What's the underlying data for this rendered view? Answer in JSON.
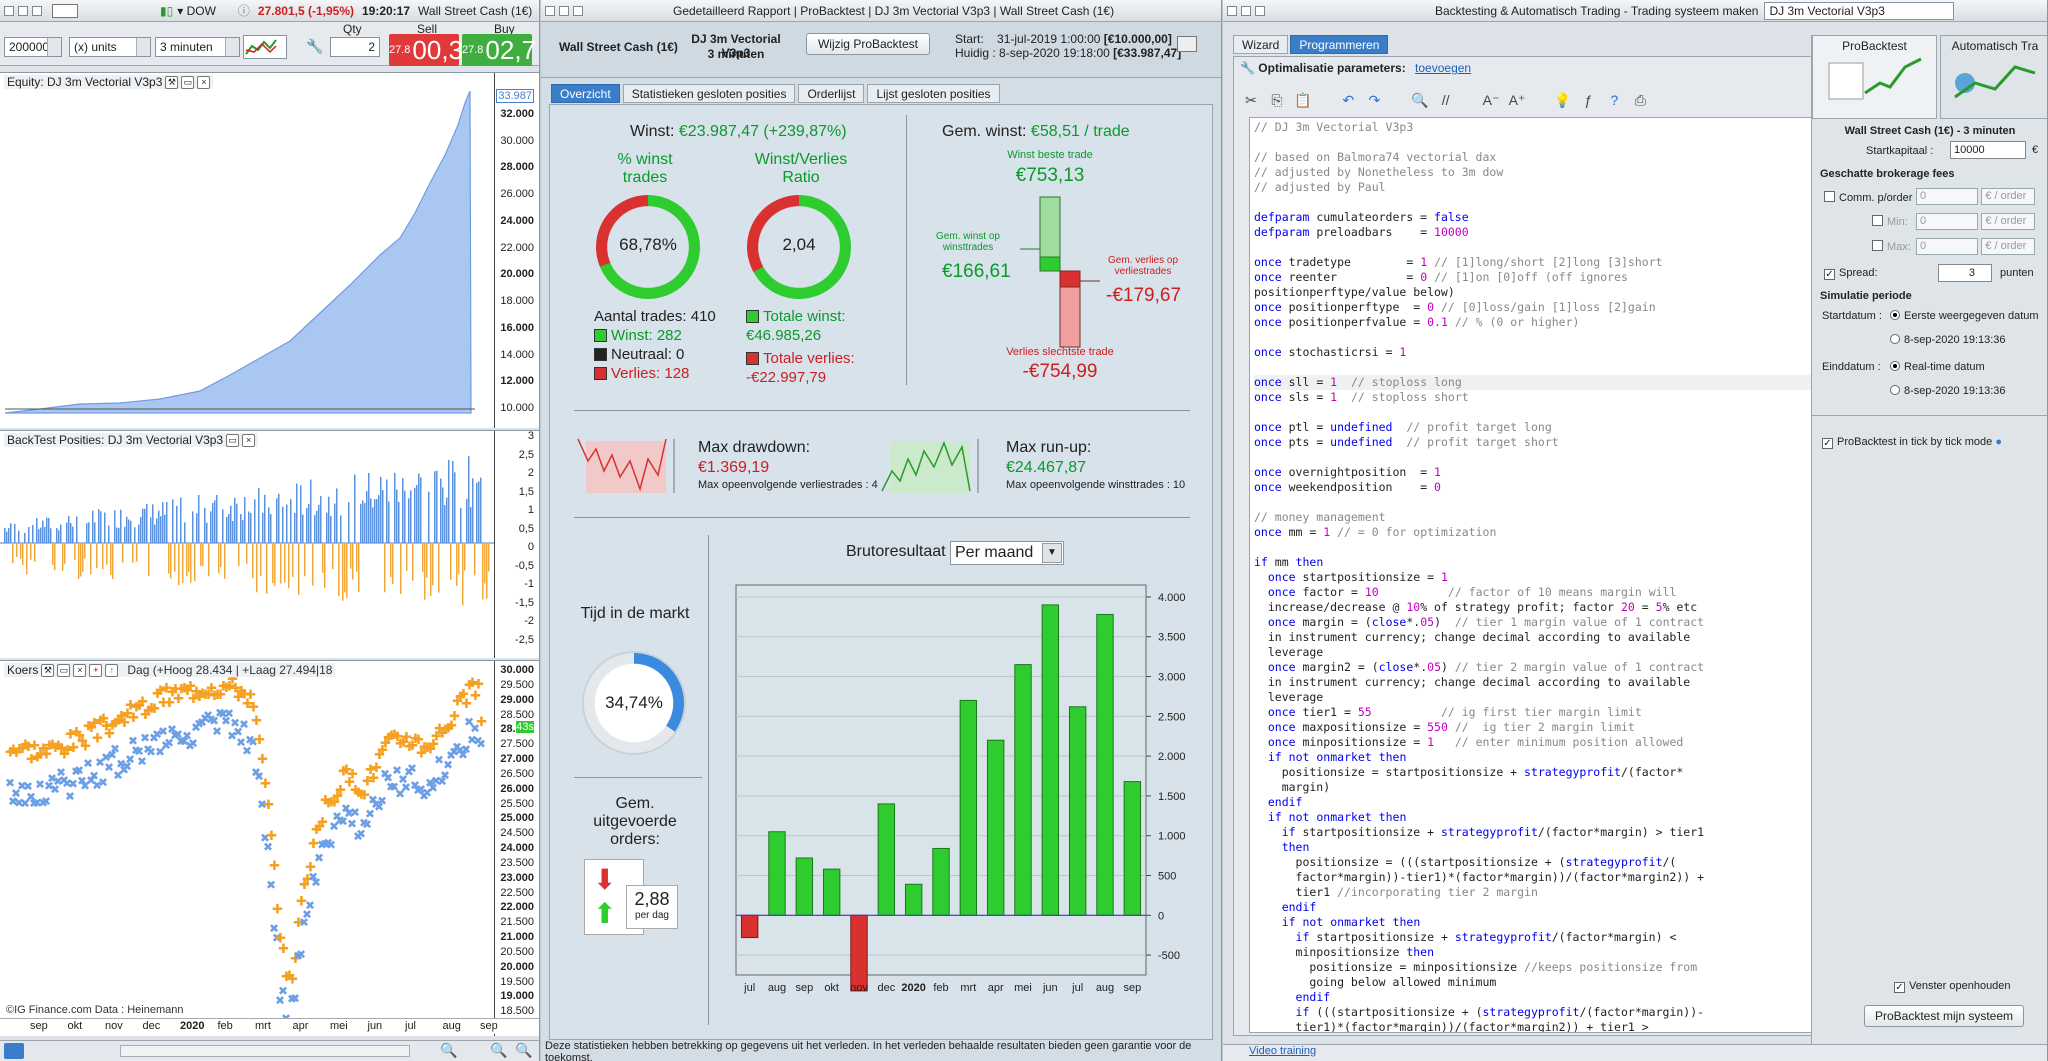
{
  "w1": {
    "title_instrument": "DOW",
    "quote": "27.801,5 (-1,95%)",
    "time": "19:20:17",
    "title_market": "Wall Street Cash (1€)",
    "qty_label": "Qty",
    "sell_label": "Sell",
    "buy_label": "Buy",
    "units_value": "200000",
    "units_select": "(x) units",
    "interval_select": "3 minuten",
    "qty_value": "2",
    "sell_small": "27.8",
    "sell_big": "00,3",
    "buy_small": "27.8",
    "buy_big": "02,7",
    "equity_title": "Equity: DJ 3m Vectorial V3p3",
    "equity_last": "33.987",
    "equity_ticks": [
      "32.000",
      "30.000",
      "28.000",
      "26.000",
      "24.000",
      "22.000",
      "20.000",
      "18.000",
      "16.000",
      "14.000",
      "12.000",
      "10.000"
    ],
    "pos_title": "BackTest Posities: DJ 3m Vectorial V3p3",
    "pos_ticks": [
      "3",
      "2,5",
      "2",
      "1,5",
      "1",
      "0,5",
      "0",
      "-0,5",
      "-1",
      "-1,5",
      "-2",
      "-2,5"
    ],
    "koers_title": "Koers",
    "koers_info": "Dag (+Hoog 28.434 | +Laag 27.494|18",
    "koers_ticks": [
      "30.000",
      "29.500",
      "29.000",
      "28.500",
      "28.000",
      "27.500",
      "27.000",
      "26.500",
      "26.000",
      "25.500",
      "25.000",
      "24.500",
      "24.000",
      "23.500",
      "23.000",
      "22.500",
      "22.000",
      "21.500",
      "21.000",
      "20.500",
      "20.000",
      "19.500",
      "19.000",
      "18.500",
      "18.000"
    ],
    "koers_label": "43s",
    "x_labels": [
      "sep",
      "okt",
      "nov",
      "dec",
      "2020",
      "feb",
      "mrt",
      "apr",
      "mei",
      "jun",
      "jul",
      "aug",
      "sep"
    ],
    "footer_text": "©IG Finance.com  Data : Heinemann"
  },
  "w2": {
    "title": "Gedetailleerd Rapport | ProBacktest | DJ 3m Vectorial V3p3 | Wall Street Cash (1€)",
    "instrument": "Wall Street Cash (1€)",
    "system": "DJ 3m Vectorial V3p3",
    "interval": "3 minuten",
    "edit_button": "Wijzig ProBacktest",
    "start_label": "Start:",
    "start_value": "31-jul-2019 1:00:00",
    "start_amount": "[€10.000,00]",
    "now_label": "Huidig :",
    "now_value": "8-sep-2020 19:18:00",
    "now_amount": "[€33.987,47]",
    "tabs": [
      "Overzicht",
      "Statistieken gesloten posities",
      "Orderlijst",
      "Lijst gesloten posities"
    ],
    "winst_label": "Winst:",
    "winst_value": "€23.987,47 (+239,87%)",
    "pct_title": "% winst trades",
    "pct_value": "68,78%",
    "pct_fraction": 0.6878,
    "ratio_title": "Winst/Verlies Ratio",
    "ratio_value": "2,04",
    "ratio_fraction": 0.67,
    "trades_line": "Aantal trades: 410",
    "winst_line": "Winst: 282",
    "neutraal_line": "Neutraal: 0",
    "verlies_line": "Verlies: 128",
    "totale_winst_label": "Totale winst:",
    "totale_winst": "€46.985,26",
    "totale_verlies_label": "Totale verlies:",
    "totale_verlies": "-€22.997,79",
    "gem_label": "Gem. winst:",
    "gem_value": "€58,51 / trade",
    "best_label": "Winst beste trade",
    "best_value": "€753,13",
    "gem_winst_label": "Gem. winst op winsttrades",
    "gem_winst_value": "€166,61",
    "gem_verlies_label": "Gem. verlies op verliestrades",
    "gem_verlies_value": "-€179,67",
    "worst_label": "Verlies slechtste trade",
    "worst_value": "-€754,99",
    "dd_label": "Max drawdown:",
    "dd_value": "€1.369,19",
    "dd_sub": "Max opeenvolgende verliestrades : 4",
    "ru_label": "Max run-up:",
    "ru_value": "€24.467,87",
    "ru_sub": "Max opeenvolgende winsttrades : 10",
    "tijd_label": "Tijd in de markt",
    "tijd_value": "34,74%",
    "tijd_fraction": 0.3474,
    "orders_label": "Gem. uitgevoerde orders:",
    "orders_value": "2,88",
    "orders_unit": "per dag",
    "bruto_label": "Brutoresultaat",
    "bruto_select": "Per maand",
    "footer": "Deze statistieken hebben betrekking op gegevens uit het verleden. In het verleden behaalde resultaten bieden geen garantie voor de toekomst."
  },
  "chart_data": {
    "type": "bar",
    "title": "Brutoresultaat",
    "categories": [
      "jul",
      "aug",
      "sep",
      "okt",
      "nov",
      "dec",
      "2020",
      "feb",
      "mrt",
      "apr",
      "mei",
      "jun",
      "jul",
      "aug",
      "sep"
    ],
    "values": [
      -280,
      1050,
      720,
      580,
      -950,
      1400,
      390,
      840,
      2700,
      2200,
      3150,
      3900,
      2620,
      3780,
      1680
    ],
    "ylim": [
      -750,
      4150
    ],
    "yticks": [
      4000,
      3500,
      3000,
      2500,
      2000,
      1500,
      1000,
      500,
      0,
      -500
    ],
    "ytick_labels": [
      "4.000",
      "3.500",
      "3.000",
      "2.500",
      "2.000",
      "1.500",
      "1.000",
      "500",
      "0",
      "-500"
    ],
    "colors": {
      "positive": "#2fcc2f",
      "negative": "#d93030"
    },
    "grid": true
  },
  "w3": {
    "title": "Backtesting & Automatisch Trading - Trading systeem maken",
    "title_field": "DJ 3m Vectorial V3p3",
    "tabs": [
      "Wizard",
      "Programmeren"
    ],
    "opt_label": "Optimalisatie parameters:",
    "opt_link": "toevoegen",
    "right_tabs": [
      "ProBacktest",
      "Automatisch Tra"
    ],
    "instrument": "Wall Street Cash (1€) - 3 minuten",
    "kapitaal_label": "Startkapitaal :",
    "kapitaal_value": "10000",
    "kapitaal_unit": "€",
    "fees_label": "Geschatte brokerage fees",
    "comm_label": "Comm. p/order :",
    "min_label": "Min:",
    "max_label": "Max:",
    "fee_value": "0",
    "fee_unit": "€ / order",
    "spread_label": "Spread:",
    "spread_value": "3",
    "spread_unit": "punten",
    "sim_label": "Simulatie periode",
    "startdatum_label": "Startdatum :",
    "start_opt1": "Eerste weergegeven datum",
    "start_opt2": "8-sep-2020 19:13:36",
    "einddatum_label": "Einddatum :",
    "end_opt1": "Real-time datum",
    "end_opt2": "8-sep-2020 19:13:36",
    "tick_label": "ProBacktest in tick by tick mode",
    "venster_label": "Venster openhouden",
    "run_button": "ProBacktest mijn systeem",
    "video_link": "Video training"
  },
  "code_lines": [
    {
      "n": "1",
      "t": "// DJ 3m Vectorial V3p3"
    },
    {
      "n": "2",
      "t": ""
    },
    {
      "n": "3",
      "t": "// based on Balmora74 vectorial dax"
    },
    {
      "n": "4",
      "t": "// adjusted by Nonetheless to 3m dow"
    },
    {
      "n": "5",
      "t": "// adjusted by Paul"
    },
    {
      "n": "6",
      "t": ""
    },
    {
      "n": "7",
      "t": "defparam cumulateorders = false"
    },
    {
      "n": "8",
      "t": "defparam preloadbars    = 10000"
    },
    {
      "n": "9",
      "t": ""
    },
    {
      "n": "10",
      "t": "once tradetype        = 1 // [1]long/short [2]long [3]short"
    },
    {
      "n": "11",
      "t": "once reenter          = 0 // [1]on [0]off (off ignores"
    },
    {
      "n": "",
      "t": "positionperftype/value below)"
    },
    {
      "n": "12",
      "t": "once positionperftype  = 0 // [0]loss/gain [1]loss [2]gain"
    },
    {
      "n": "13",
      "t": "once positionperfvalue = 0.1 // % (0 or higher)"
    },
    {
      "n": "14",
      "t": ""
    },
    {
      "n": "15",
      "t": "once stochasticrsi = 1"
    },
    {
      "n": "16",
      "t": ""
    },
    {
      "n": "17",
      "t": "once sll = 1  // stoploss long"
    },
    {
      "n": "18",
      "t": "once sls = 1  // stoploss short"
    },
    {
      "n": "19",
      "t": ""
    },
    {
      "n": "20",
      "t": "once ptl = undefined  // profit target long"
    },
    {
      "n": "21",
      "t": "once pts = undefined  // profit target short"
    },
    {
      "n": "22",
      "t": ""
    },
    {
      "n": "23",
      "t": "once overnightposition  = 1"
    },
    {
      "n": "24",
      "t": "once weekendposition    = 0"
    },
    {
      "n": "25",
      "t": ""
    },
    {
      "n": "26",
      "t": "// money management"
    },
    {
      "n": "27",
      "t": "once mm = 1 // = 0 for optimization"
    },
    {
      "n": "28",
      "t": ""
    },
    {
      "n": "29",
      "t": "if mm then"
    },
    {
      "n": "30",
      "t": "  once startpositionsize = 1"
    },
    {
      "n": "31",
      "t": "  once factor = 10          // factor of 10 means margin will"
    },
    {
      "n": "",
      "t": "  increase/decrease @ 10% of strategy profit; factor 20 = 5% etc"
    },
    {
      "n": "32",
      "t": "  once margin = (close*.05)  // tier 1 margin value of 1 contract"
    },
    {
      "n": "",
      "t": "  in instrument currency; change decimal according to available"
    },
    {
      "n": "",
      "t": "  leverage"
    },
    {
      "n": "33",
      "t": "  once margin2 = (close*.05) // tier 2 margin value of 1 contract"
    },
    {
      "n": "",
      "t": "  in instrument currency; change decimal according to available"
    },
    {
      "n": "",
      "t": "  leverage"
    },
    {
      "n": "34",
      "t": "  once tier1 = 55          // ig first tier margin limit"
    },
    {
      "n": "35",
      "t": "  once maxpositionsize = 550 //  ig tier 2 margin limit"
    },
    {
      "n": "36",
      "t": "  once minpositionsize = 1   // enter minimum position allowed"
    },
    {
      "n": "37",
      "t": "  if not onmarket then"
    },
    {
      "n": "38",
      "t": "    positionsize = startpositionsize + strategyprofit/(factor*"
    },
    {
      "n": "",
      "t": "    margin)"
    },
    {
      "n": "39",
      "t": "  endif"
    },
    {
      "n": "40",
      "t": "  if not onmarket then"
    },
    {
      "n": "41",
      "t": "    if startpositionsize + strategyprofit/(factor*margin) > tier1"
    },
    {
      "n": "",
      "t": "    then"
    },
    {
      "n": "42",
      "t": "      positionsize = (((startpositionsize + (strategyprofit/("
    },
    {
      "n": "",
      "t": "      factor*margin))-tier1)*(factor*margin))/(factor*margin2)) +"
    },
    {
      "n": "",
      "t": "      tier1 //incorporating tier 2 margin"
    },
    {
      "n": "43",
      "t": "    endif"
    },
    {
      "n": "44",
      "t": "    if not onmarket then"
    },
    {
      "n": "45",
      "t": "      if startpositionsize + strategyprofit/(factor*margin) <"
    },
    {
      "n": "",
      "t": "      minpositionsize then"
    },
    {
      "n": "46",
      "t": "        positionsize = minpositionsize //keeps positionsize from"
    },
    {
      "n": "",
      "t": "        going below allowed minimum"
    },
    {
      "n": "47",
      "t": "      endif"
    },
    {
      "n": "48",
      "t": "      if (((startpositionsize + (strategyprofit/(factor*margin))-"
    },
    {
      "n": "",
      "t": "      tier1)*(factor*margin))/(factor*margin2)) + tier1 >"
    }
  ]
}
